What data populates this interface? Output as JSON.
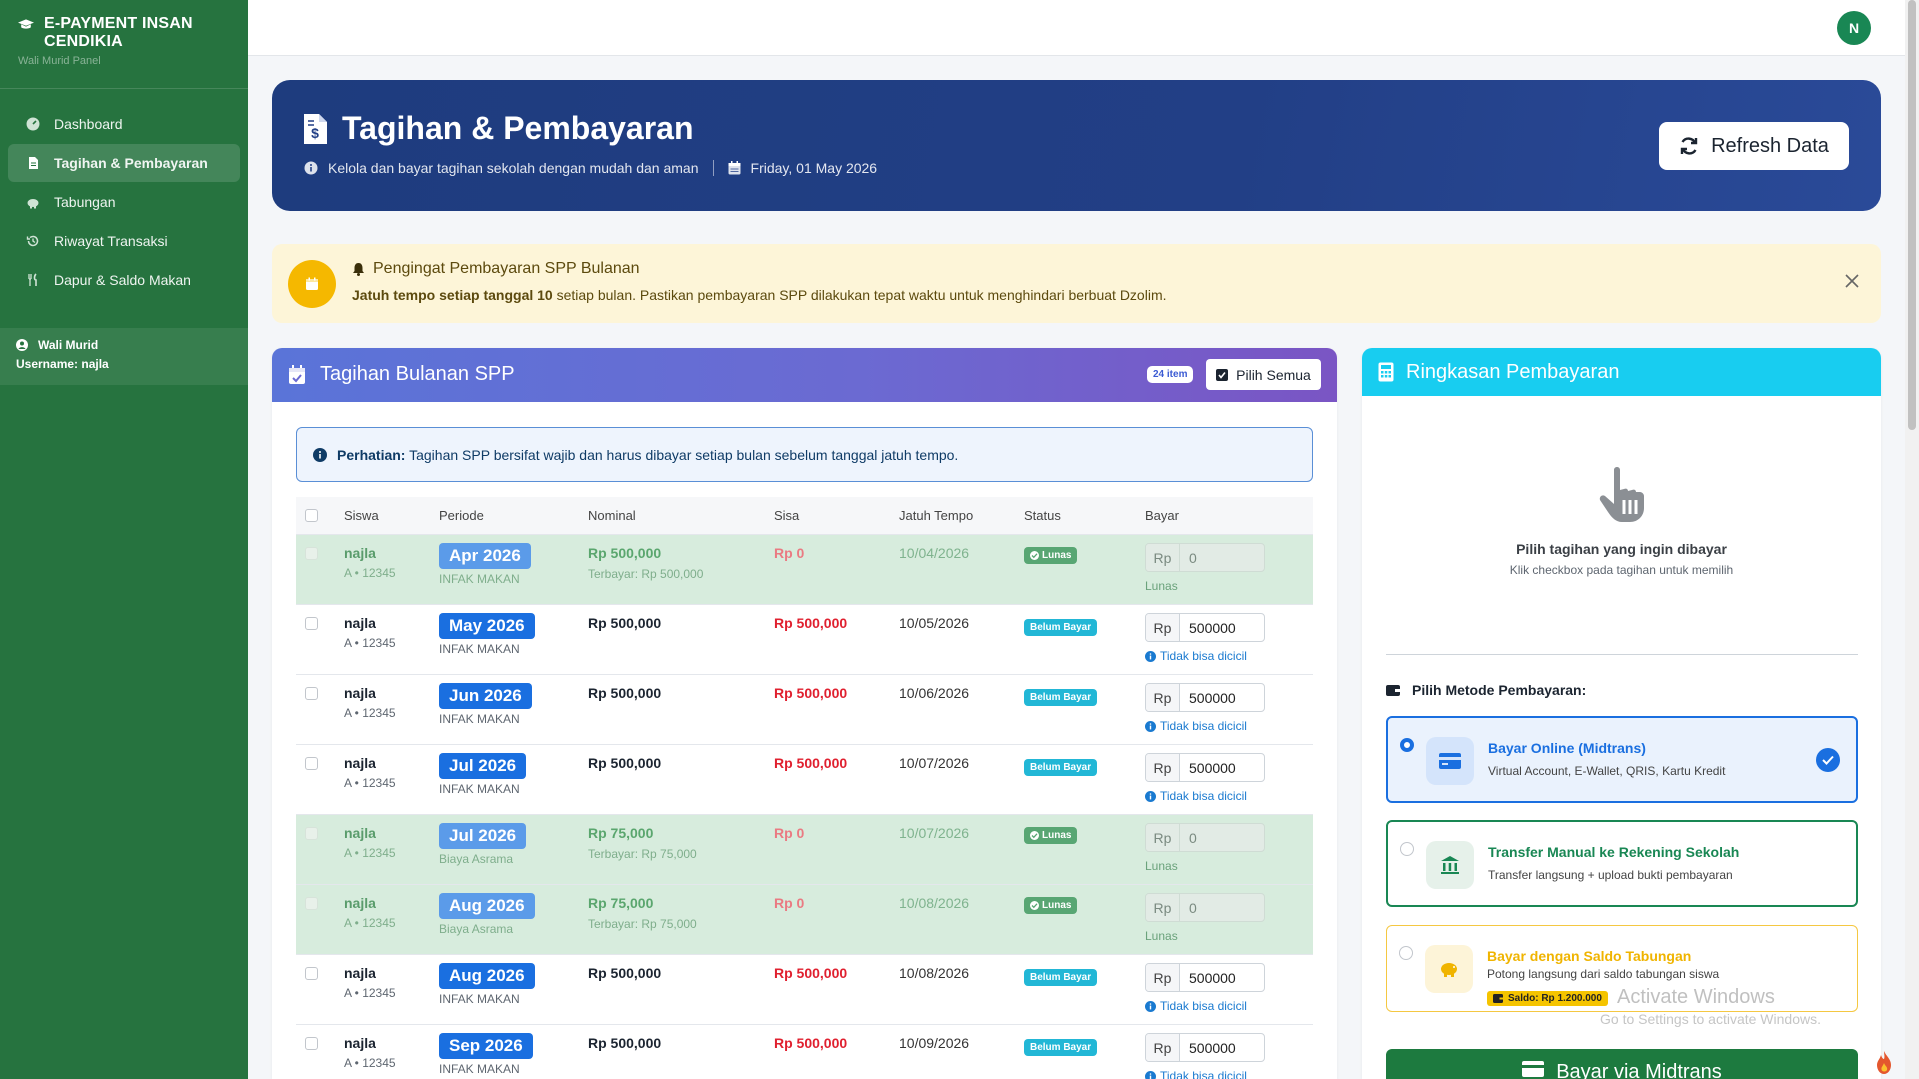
{
  "app": {
    "brand_title": "E-PAYMENT INSAN CENDIKIA",
    "brand_sub": "Wali Murid Panel"
  },
  "sidebar": {
    "items": [
      {
        "label": "Dashboard",
        "icon": "dashboard-icon"
      },
      {
        "label": "Tagihan & Pembayaran",
        "icon": "invoice-icon",
        "active": true
      },
      {
        "label": "Tabungan",
        "icon": "piggy-bank-icon"
      },
      {
        "label": "Riwayat Transaksi",
        "icon": "history-icon"
      },
      {
        "label": "Dapur & Saldo Makan",
        "icon": "utensils-icon"
      }
    ],
    "user": {
      "role": "Wali Murid",
      "username": "Username: najla"
    }
  },
  "topbar": {
    "avatar_initial": "N"
  },
  "header": {
    "title": "Tagihan & Pembayaran",
    "subtitle": "Kelola dan bayar tagihan sekolah dengan mudah dan aman",
    "date": "Friday, 01 May 2026",
    "refresh_label": "Refresh Data"
  },
  "reminder": {
    "title": "Pengingat Pembayaran SPP Bulanan",
    "text_bold": "Jatuh tempo setiap tanggal 10",
    "text_rest": " setiap bulan. Pastikan pembayaran SPP dilakukan tepat waktu untuk menghindari berbuat Dzolim."
  },
  "bills": {
    "title": "Tagihan Bulanan SPP",
    "count_badge": "24 item",
    "select_all_label": "Pilih Semua",
    "notice_bold": "Perhatian:",
    "notice_text": "Tagihan SPP bersifat wajib dan harus dibayar setiap bulan sebelum tanggal jatuh tempo.",
    "columns": [
      "Siswa",
      "Periode",
      "Nominal",
      "Sisa",
      "Jatuh Tempo",
      "Status",
      "Bayar"
    ],
    "rows": [
      {
        "student": "najla",
        "nis": "A • 12345",
        "period": "Apr 2026",
        "type": "INFAK MAKAN",
        "nominal": "Rp 500,000",
        "paid_text": "Terbayar: Rp 500,000",
        "sisa": "Rp 0",
        "due": "10/04/2026",
        "status": "Lunas",
        "paid": true,
        "prefix": "Rp",
        "amount": "0",
        "note": "Lunas"
      },
      {
        "student": "najla",
        "nis": "A • 12345",
        "period": "May 2026",
        "type": "INFAK MAKAN",
        "nominal": "Rp 500,000",
        "paid_text": "",
        "sisa": "Rp 500,000",
        "due": "10/05/2026",
        "status": "Belum Bayar",
        "paid": false,
        "prefix": "Rp",
        "amount": "500000",
        "note": "Tidak bisa dicicil"
      },
      {
        "student": "najla",
        "nis": "A • 12345",
        "period": "Jun 2026",
        "type": "INFAK MAKAN",
        "nominal": "Rp 500,000",
        "paid_text": "",
        "sisa": "Rp 500,000",
        "due": "10/06/2026",
        "status": "Belum Bayar",
        "paid": false,
        "prefix": "Rp",
        "amount": "500000",
        "note": "Tidak bisa dicicil"
      },
      {
        "student": "najla",
        "nis": "A • 12345",
        "period": "Jul 2026",
        "type": "INFAK MAKAN",
        "nominal": "Rp 500,000",
        "paid_text": "",
        "sisa": "Rp 500,000",
        "due": "10/07/2026",
        "status": "Belum Bayar",
        "paid": false,
        "prefix": "Rp",
        "amount": "500000",
        "note": "Tidak bisa dicicil"
      },
      {
        "student": "najla",
        "nis": "A • 12345",
        "period": "Jul 2026",
        "type": "Biaya Asrama",
        "nominal": "Rp 75,000",
        "paid_text": "Terbayar: Rp 75,000",
        "sisa": "Rp 0",
        "due": "10/07/2026",
        "status": "Lunas",
        "paid": true,
        "prefix": "Rp",
        "amount": "0",
        "note": "Lunas"
      },
      {
        "student": "najla",
        "nis": "A • 12345",
        "period": "Aug 2026",
        "type": "Biaya Asrama",
        "nominal": "Rp 75,000",
        "paid_text": "Terbayar: Rp 75,000",
        "sisa": "Rp 0",
        "due": "10/08/2026",
        "status": "Lunas",
        "paid": true,
        "prefix": "Rp",
        "amount": "0",
        "note": "Lunas"
      },
      {
        "student": "najla",
        "nis": "A • 12345",
        "period": "Aug 2026",
        "type": "INFAK MAKAN",
        "nominal": "Rp 500,000",
        "paid_text": "",
        "sisa": "Rp 500,000",
        "due": "10/08/2026",
        "status": "Belum Bayar",
        "paid": false,
        "prefix": "Rp",
        "amount": "500000",
        "note": "Tidak bisa dicicil"
      },
      {
        "student": "najla",
        "nis": "A • 12345",
        "period": "Sep 2026",
        "type": "INFAK MAKAN",
        "nominal": "Rp 500,000",
        "paid_text": "",
        "sisa": "Rp 500,000",
        "due": "10/09/2026",
        "status": "Belum Bayar",
        "paid": false,
        "prefix": "Rp",
        "amount": "500000",
        "note": "Tidak bisa dicicil"
      }
    ]
  },
  "summary": {
    "title": "Ringkasan Pembayaran",
    "empty_title": "Pilih tagihan yang ingin dibayar",
    "empty_sub": "Klik checkbox pada tagihan untuk memilih",
    "method_title": "Pilih Metode Pembayaran:",
    "methods": [
      {
        "title": "Bayar Online (Midtrans)",
        "sub": "Virtual Account, E-Wallet, QRIS, Kartu Kredit",
        "selected": true,
        "color": "#1a6fe0"
      },
      {
        "title": "Transfer Manual ke Rekening Sekolah",
        "sub": "Transfer langsung + upload bukti pembayaran",
        "selected": false,
        "color": "#198754"
      },
      {
        "title": "Bayar dengan Saldo Tabungan",
        "sub": "Potong langsung dari saldo tabungan siswa",
        "selected": false,
        "color": "#f0b400",
        "badge": "Saldo: Rp 1.200.000"
      }
    ],
    "pay_button": "Bayar via Midtrans"
  },
  "overlay": {
    "watermark": "Activate Windows",
    "watermark_sub": "Go to Settings to activate Windows."
  }
}
